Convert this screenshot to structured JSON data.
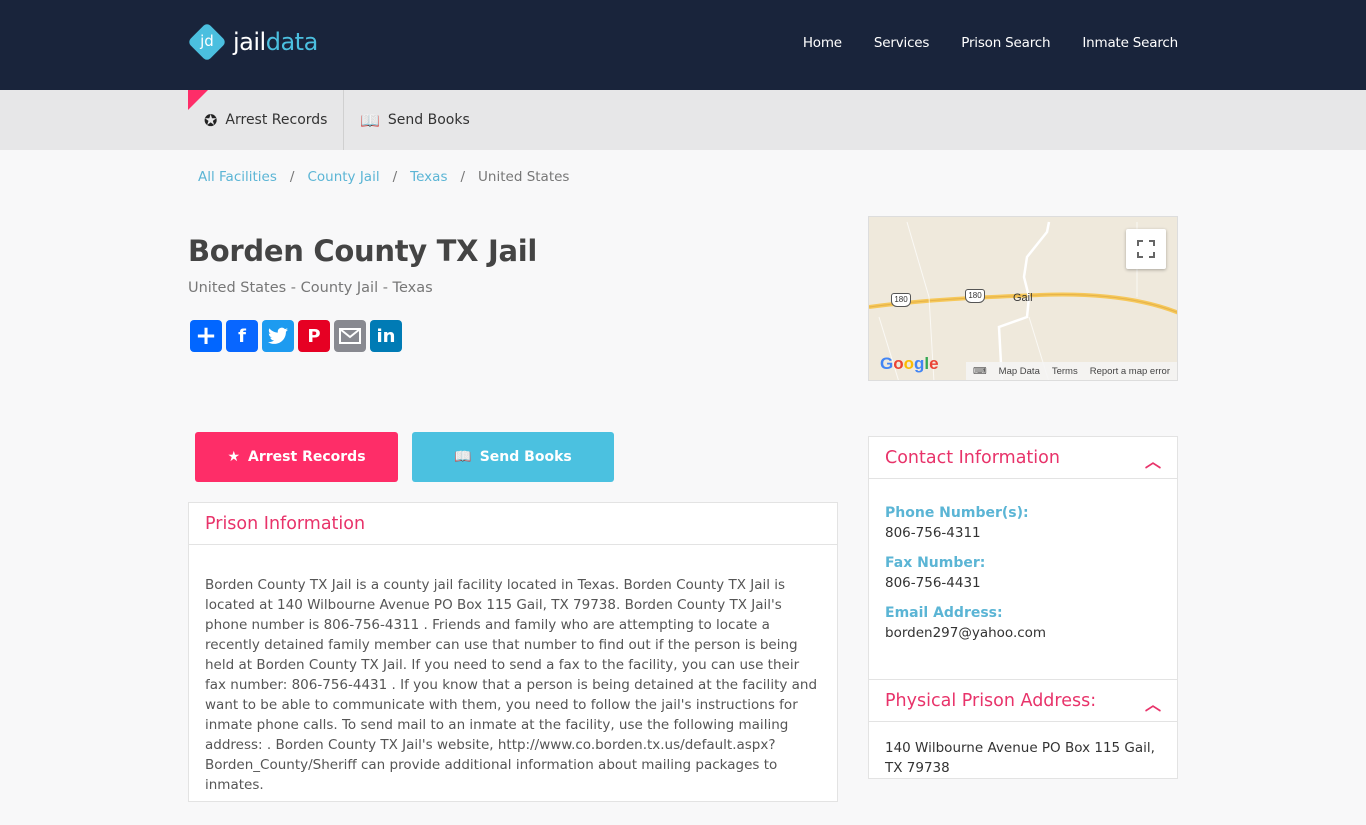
{
  "header": {
    "logo_mark": "jd",
    "logo_text_a": "jail",
    "logo_text_b": "data",
    "nav": [
      "Home",
      "Services",
      "Prison Search",
      "Inmate Search"
    ]
  },
  "subnav": {
    "arrest_label": "Arrest Records",
    "books_label": "Send Books"
  },
  "breadcrumb": {
    "items": [
      "All Facilities",
      "County Jail",
      "Texas"
    ],
    "current": "United States",
    "separator": "/"
  },
  "page": {
    "title": "Borden County TX Jail",
    "subtitle": "United States - County Jail - Texas"
  },
  "share": {
    "icons": [
      "add-icon",
      "facebook-icon",
      "twitter-icon",
      "pinterest-icon",
      "email-icon",
      "linkedin-icon"
    ]
  },
  "map": {
    "place": "Gail",
    "route": "180",
    "brand": "Google",
    "footer": [
      "Map Data",
      "Terms",
      "Report a map error"
    ]
  },
  "actions": {
    "arrest_label": "Arrest Records",
    "books_label": "Send Books",
    "arrest_color": "#fe2d68",
    "books_color": "#4bc1e0"
  },
  "info": {
    "heading": "Prison Information",
    "text": "Borden County TX Jail is a county jail facility located in Texas. Borden County TX Jail is located at 140 Wilbourne Avenue PO Box 115 Gail, TX 79738. Borden County TX Jail's phone number is 806-756-4311 . Friends and family who are attempting to locate a recently detained family member can use that number to find out if the person is being held at Borden County TX Jail. If you need to send a fax to the facility, you can use their fax number: 806-756-4431 . If you know that a person is being detained at the facility and want to be able to communicate with them, you need to follow the jail's instructions for inmate phone calls. To send mail to an inmate at the facility, use the following mailing address: . Borden County TX Jail's website, http://www.co.borden.tx.us/default.aspx?Borden_County/Sheriff can provide additional information about mailing packages to inmates."
  },
  "contact": {
    "heading": "Contact Information",
    "phone_label": "Phone Number(s):",
    "phone": "806-756-4311",
    "fax_label": "Fax Number:",
    "fax": "806-756-4431",
    "email_label": "Email Address:",
    "email": "borden297@yahoo.com"
  },
  "address": {
    "heading": "Physical Prison Address:",
    "text": "140 Wilbourne Avenue PO Box 115 Gail, TX 79738"
  }
}
